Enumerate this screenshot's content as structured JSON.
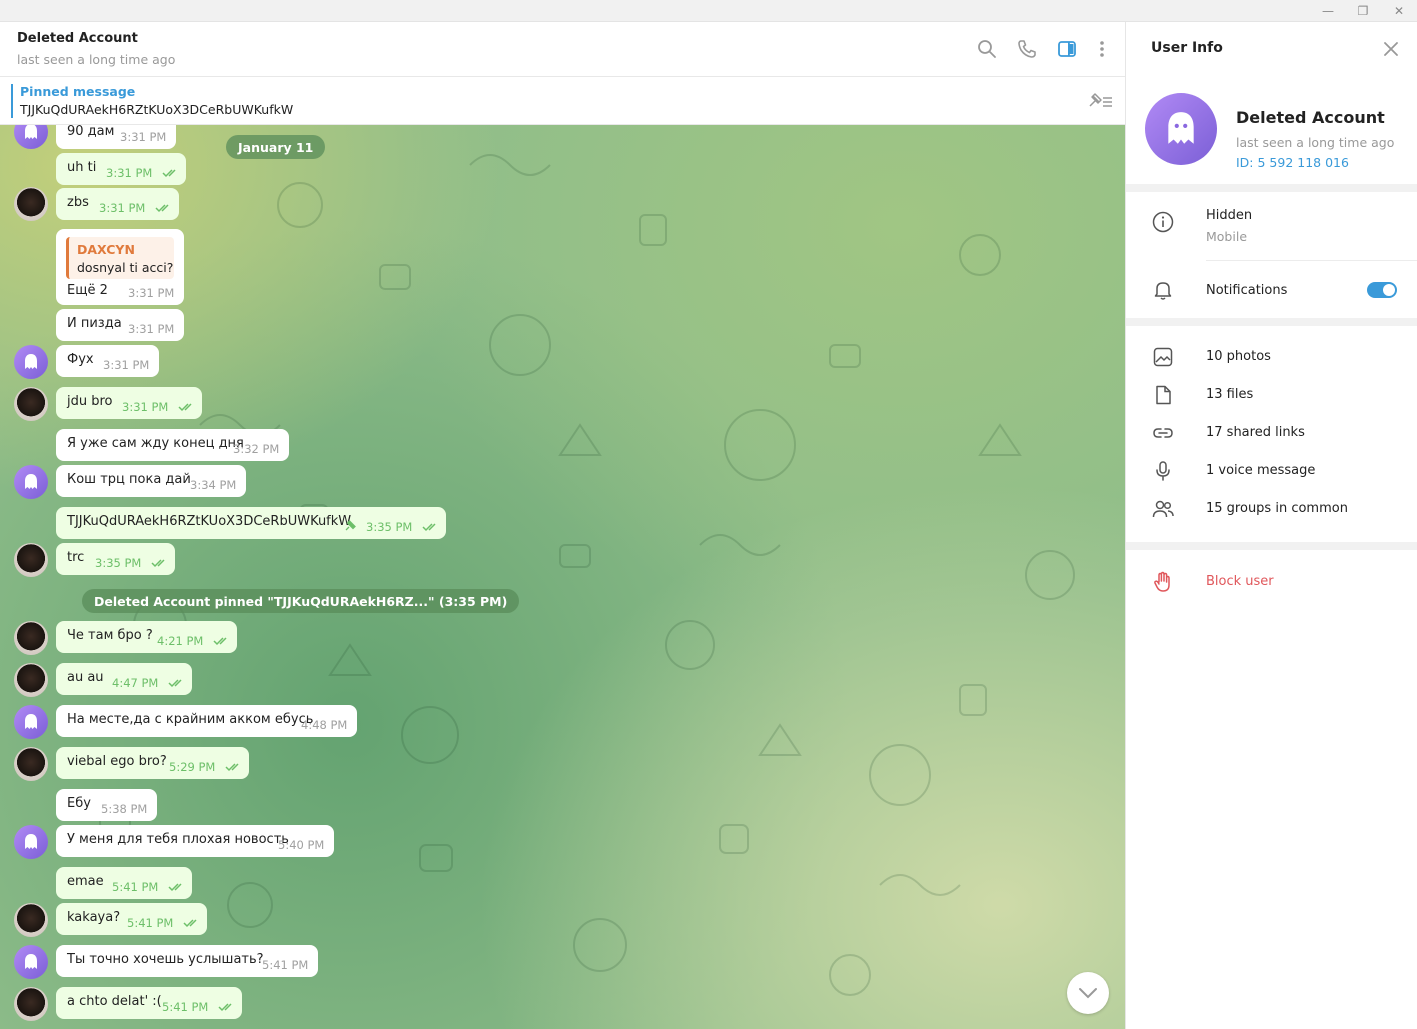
{
  "window": {
    "minimize": "—",
    "restore": "❐",
    "close": "✕"
  },
  "header": {
    "title": "Deleted Account",
    "status": "last seen a long time ago"
  },
  "pinned": {
    "label": "Pinned message",
    "text": "TJJKuQdURAekH6RZtKUoX3DCeRbUWKufkW"
  },
  "date_badge": "January 11",
  "service_pinned": "Deleted Account pinned \"TJJKuQdURAekH6RZ...\" (3:35 PM)",
  "messages": [
    {
      "text": "90 дам",
      "time": "3:31 PM"
    },
    {
      "text": "uh ti",
      "time": "3:31 PM"
    },
    {
      "text": "zbs",
      "time": "3:31 PM"
    },
    {
      "reply_name": "DAXCYN",
      "reply_text": "dosnyal ti acci?",
      "text": "Ещё 2",
      "time": "3:31 PM"
    },
    {
      "text": "И пизда",
      "time": "3:31 PM"
    },
    {
      "text": "Фух",
      "time": "3:31 PM"
    },
    {
      "text": "jdu bro",
      "time": "3:31 PM"
    },
    {
      "text": "Я уже сам жду конец дня",
      "time": "3:32 PM"
    },
    {
      "text": "Кош трц пока дай",
      "time": "3:34 PM"
    },
    {
      "text": "TJJKuQdURAekH6RZtKUoX3DCeRbUWKufkW",
      "time": "3:35 PM"
    },
    {
      "text": "trc",
      "time": "3:35 PM"
    },
    {
      "text": "Че там бро ?",
      "time": "4:21 PM"
    },
    {
      "text": "au au",
      "time": "4:47 PM"
    },
    {
      "text": "На месте,да с крайним акком ебусь",
      "time": "4:48 PM"
    },
    {
      "text": "viebal ego bro?",
      "time": "5:29 PM"
    },
    {
      "text": "Ебу",
      "time": "5:38 PM"
    },
    {
      "text": "У меня для тебя плохая новость",
      "time": "5:40 PM"
    },
    {
      "text": "emae",
      "time": "5:41 PM"
    },
    {
      "text": "kakaya?",
      "time": "5:41 PM"
    },
    {
      "text": "Ты точно хочешь услышать?",
      "time": "5:41 PM"
    },
    {
      "text": "a chto delat' :(",
      "time": "5:41 PM"
    }
  ],
  "panel": {
    "title": "User Info",
    "name": "Deleted Account",
    "status": "last seen a long time ago",
    "id": "ID: 5 592 118 016",
    "phone": "Hidden",
    "phone_label": "Mobile",
    "notifications": "Notifications",
    "notifications_enabled": true,
    "photos": "10 photos",
    "files": "13 files",
    "links": "17 shared links",
    "voice": "1 voice message",
    "groups": "15 groups in common",
    "block": "Block user"
  },
  "colors": {
    "accent": "#3a9ad9",
    "danger": "#e0575b",
    "outgoing_bubble": "#eefee3",
    "check": "#6dbf69"
  }
}
